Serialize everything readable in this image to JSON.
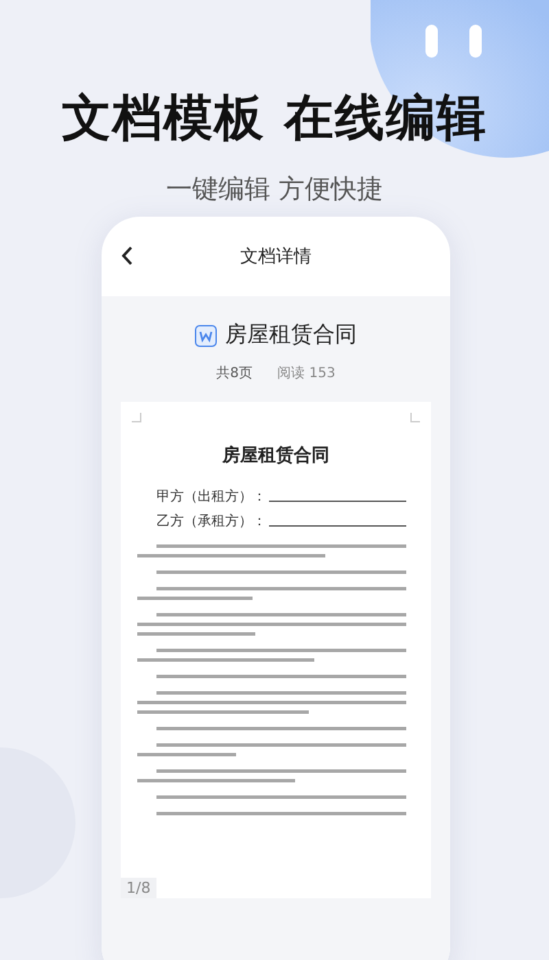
{
  "headline": "文档模板 在线编辑",
  "subheadline": "一键编辑 方便快捷",
  "screen": {
    "title": "文档详情",
    "document": {
      "name": "房屋租赁合同",
      "pages": "共8页",
      "reads": "阅读 153"
    },
    "page": {
      "title": "房屋租赁合同",
      "parties": [
        "甲方（出租方）：",
        "乙方（承租方）："
      ]
    },
    "page_indicator": "1/8"
  }
}
